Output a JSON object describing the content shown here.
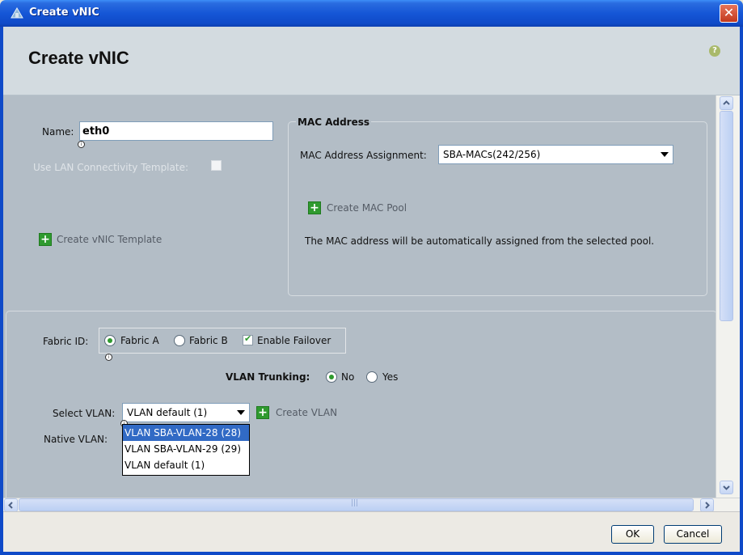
{
  "window": {
    "title": "Create vNIC",
    "close_label": "✕"
  },
  "header": {
    "title": "Create vNIC",
    "help_label": "?"
  },
  "form": {
    "name_label": "Name:",
    "name_value": "eth0",
    "use_lan_template_label": "Use LAN Connectivity Template:",
    "create_vnic_template_label": "Create vNIC Template"
  },
  "mac": {
    "group_title": "MAC Address",
    "assignment_label": "MAC Address Assignment:",
    "assignment_value": "SBA-MACs(242/256)",
    "create_pool_label": "Create MAC Pool",
    "info_text": "The MAC address will be automatically assigned from the selected pool."
  },
  "fabric": {
    "label": "Fabric ID:",
    "option_a": "Fabric A",
    "option_b": "Fabric B",
    "selected": "Fabric A",
    "enable_failover_label": "Enable Failover",
    "enable_failover_checked": true
  },
  "vlan": {
    "trunking_label": "VLAN Trunking:",
    "trunking_no": "No",
    "trunking_yes": "Yes",
    "trunking_selected": "No",
    "select_label": "Select VLAN:",
    "select_value": "VLAN default (1)",
    "create_vlan_label": "Create VLAN",
    "native_label": "Native VLAN:",
    "options": [
      "VLAN SBA-VLAN-28 (28)",
      "VLAN SBA-VLAN-29 (29)",
      "VLAN default (1)"
    ],
    "highlighted_option": "VLAN SBA-VLAN-28 (28)"
  },
  "buttons": {
    "ok": "OK",
    "cancel": "Cancel"
  },
  "scrollbar": {
    "h_grip": "|||"
  },
  "colors": {
    "titlebar": "#1556d6",
    "content_bg": "#b3bdc6",
    "header_bg": "#d3dbe0",
    "selection": "#316ac5",
    "plus_green": "#2f9a2f"
  }
}
